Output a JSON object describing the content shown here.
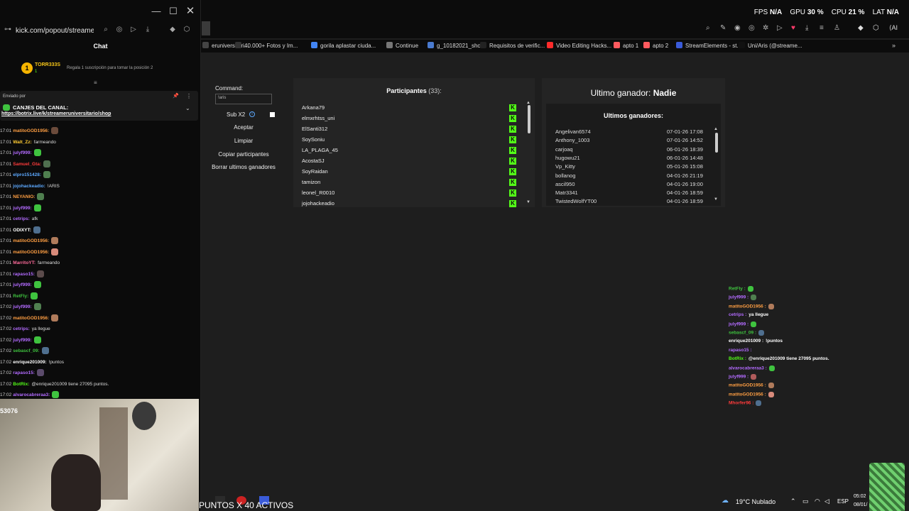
{
  "chat_window": {
    "url": "kick.com/popout/streameru",
    "title": "Chat",
    "top_gifter": {
      "name": "TORR333S",
      "sub": "1",
      "message": "Regala 1 suscripción para tomar la posición 2"
    },
    "pinned": {
      "sent_by": "Enviado por",
      "title": "CANJES DEL CANAL:",
      "link": "https://botrix.live/k/streameruniversitario/shop"
    },
    "messages": [
      {
        "time": "17:01",
        "user": "matitoGOD1956:",
        "color": "#ff9f43",
        "text": "",
        "emote": "#6b4b3b"
      },
      {
        "time": "17:01",
        "user": "Walt_Zz:",
        "color": "#ffcc33",
        "text": "farmeando",
        "emote": ""
      },
      {
        "time": "17:01",
        "user": "julyf999:",
        "color": "#b36bff",
        "text": "",
        "emote": "#3fc33f"
      },
      {
        "time": "17:01",
        "user": "Samuel_Gta:",
        "color": "#ff3b3b",
        "text": "",
        "emote": "#4f6f4f"
      },
      {
        "time": "17:01",
        "user": "elpro151428:",
        "color": "#5da9ff",
        "text": "",
        "emote": "#4f7f4f"
      },
      {
        "time": "17:01",
        "user": "jojohackeadio:",
        "color": "#5da9ff",
        "text": "!ARIS",
        "emote": ""
      },
      {
        "time": "17:01",
        "user": "NEYANIO:",
        "color": "#ff9f43",
        "text": "",
        "emote": "#4f7f4f"
      },
      {
        "time": "17:01",
        "user": "julyf999:",
        "color": "#b36bff",
        "text": "",
        "emote": "#3fc33f"
      },
      {
        "time": "17:01",
        "user": "cetrips:",
        "color": "#b36bff",
        "text": "afk",
        "emote": ""
      },
      {
        "time": "17:01",
        "user": "ODIXYT:",
        "color": "#ffffff",
        "text": "",
        "emote": "#4f6f8f"
      },
      {
        "time": "17:01",
        "user": "matitoGOD1956:",
        "color": "#ff9f43",
        "text": "",
        "emote": "#b07b5b"
      },
      {
        "time": "17:01",
        "user": "matitoGOD1956:",
        "color": "#ff9f43",
        "text": "",
        "emote": "#d88b7b"
      },
      {
        "time": "17:01",
        "user": "MarritoYT:",
        "color": "#ff6b9b",
        "text": "farmeando",
        "emote": ""
      },
      {
        "time": "17:01",
        "user": "rapaso15:",
        "color": "#b36bff",
        "text": "",
        "emote": "#5b4b4b"
      },
      {
        "time": "17:01",
        "user": "julyf999:",
        "color": "#b36bff",
        "text": "",
        "emote": "#3fc33f"
      },
      {
        "time": "17:01",
        "user": "RetFly:",
        "color": "#3fc33f",
        "text": "",
        "emote": "#3fc33f"
      },
      {
        "time": "17:02",
        "user": "julyf999:",
        "color": "#b36bff",
        "text": "",
        "emote": "#4f7f4f"
      },
      {
        "time": "17:02",
        "user": "matitoGOD1956:",
        "color": "#ff9f43",
        "text": "",
        "emote": "#b07b5b"
      },
      {
        "time": "17:02",
        "user": "cetrips:",
        "color": "#b36bff",
        "text": "ya llegue",
        "emote": ""
      },
      {
        "time": "17:02",
        "user": "julyf999:",
        "color": "#b36bff",
        "text": "",
        "emote": "#3fc33f"
      },
      {
        "time": "17:02",
        "user": "sebascf_09:",
        "color": "#3fc33f",
        "text": "",
        "emote": "#4f6f8f"
      },
      {
        "time": "17:02",
        "user": "enrique201009:",
        "color": "#ffffff",
        "text": "!puntos",
        "emote": ""
      },
      {
        "time": "17:02",
        "user": "rapaso15:",
        "color": "#b36bff",
        "text": "",
        "emote": "#5b4b6b"
      },
      {
        "time": "17:02",
        "user": "BotRix:",
        "color": "#53fc18",
        "text": "@enrique201009 tiene 27095 puntos.",
        "emote": ""
      },
      {
        "time": "17:02",
        "user": "alvarocabreraa3:",
        "color": "#b36bff",
        "text": "",
        "emote": "#3fc33f"
      }
    ],
    "webcam_counter": "53076"
  },
  "stats": {
    "fps_label": "FPS",
    "fps": "N/A",
    "gpu_label": "GPU",
    "gpu": "30 %",
    "cpu_label": "CPU",
    "cpu": "21 %",
    "lat_label": "LAT",
    "lat": "N/A"
  },
  "bookmarks": [
    {
      "label": "eruniversitari...",
      "color": "#444"
    },
    {
      "label": "40.000+ Fotos y Im...",
      "color": "#333"
    },
    {
      "label": "gorila aplastar ciuda...",
      "color": "#4285f4"
    },
    {
      "label": "Continue",
      "color": "#777"
    },
    {
      "label": "g_10182021_shcc",
      "color": "#4a7bd0"
    },
    {
      "label": "Requisitos de verific...",
      "color": "#222"
    },
    {
      "label": "Video Editing Hacks...",
      "color": "#ff2b2b"
    },
    {
      "label": "apto 1",
      "color": "#ff5a5f"
    },
    {
      "label": "apto 2",
      "color": "#ff5a5f"
    },
    {
      "label": "StreamElements - st...",
      "color": "#3a5bd9"
    },
    {
      "label": "Uni/Aris (@streame...",
      "color": "#111"
    }
  ],
  "giveaway": {
    "command_label": "Command:",
    "command_value": "!aris",
    "sub_label": "Sub X2",
    "buttons": [
      "Aceptar",
      "Limpiar",
      "Copiar participantes",
      "Borrar ultimos ganadores"
    ],
    "participants_title": "Participantes",
    "participants_count": "(33):",
    "participants": [
      "Arkana79",
      "elmxrhtss_uni",
      "ElSanti312",
      "SoySoniu",
      "LA_PLAGA_45",
      "AcostaSJ",
      "SoyRaidan",
      "tamizon",
      "leonel_R0010",
      "jojohackeadio"
    ],
    "last_winner_label": "Ultimo ganador:",
    "last_winner": "Nadie",
    "winners_title": "Ultimos ganadores:",
    "winners": [
      {
        "name": "Angelivan6574",
        "date": "07-01-26 17:08"
      },
      {
        "name": "Anthony_1003",
        "date": "07-01-26 14:52"
      },
      {
        "name": "carjoaq",
        "date": "06-01-26 18:39"
      },
      {
        "name": "hugowu21",
        "date": "06-01-26 14:48"
      },
      {
        "name": "Vp_Kitty",
        "date": "05-01-26 15:08"
      },
      {
        "name": "bollanog",
        "date": "04-01-26 21:19"
      },
      {
        "name": "ascil950",
        "date": "04-01-26 19:00"
      },
      {
        "name": "Matr3341",
        "date": "04-01-26 18:59"
      },
      {
        "name": "TwistedWolfYT00",
        "date": "04-01-26 18:59"
      }
    ]
  },
  "overlay_chat": [
    {
      "user": "RetFly :",
      "color": "#3fc33f",
      "text": "",
      "emote": "#3fc33f"
    },
    {
      "user": "julyf999 :",
      "color": "#b36bff",
      "text": "",
      "emote": "#4f7f4f"
    },
    {
      "user": "matitoGOD1956 :",
      "color": "#ff9f43",
      "text": "",
      "emote": "#b07b5b"
    },
    {
      "user": "cetrips :",
      "color": "#b36bff",
      "text": "ya llegue",
      "emote": ""
    },
    {
      "user": "julyf999 :",
      "color": "#b36bff",
      "text": "",
      "emote": "#3fc33f"
    },
    {
      "user": "sebascf_09 :",
      "color": "#3fc33f",
      "text": "",
      "emote": "#4f6f8f"
    },
    {
      "user": "enrique201009 :",
      "color": "#ffffff",
      "text": "!puntos",
      "emote": ""
    },
    {
      "user": "rapaso15 :",
      "color": "#b36bff",
      "text": "",
      "emote": ""
    },
    {
      "user": "BotRix :",
      "color": "#53fc18",
      "text": "@enrique201009 tiene 27095 puntos.",
      "emote": ""
    },
    {
      "user": "alvarocabreraa3 :",
      "color": "#b36bff",
      "text": "",
      "emote": "#3fc33f"
    },
    {
      "user": "julyf999 :",
      "color": "#b36bff",
      "text": "",
      "emote": "#b05b5b"
    },
    {
      "user": "matitoGOD1956 :",
      "color": "#ff9f43",
      "text": "",
      "emote": "#b07b5b"
    },
    {
      "user": "matitoGOD1956 :",
      "color": "#ff9f43",
      "text": "",
      "emote": "#d88b7b"
    },
    {
      "user": "Mhorfer96 :",
      "color": "#ff3b3b",
      "text": "",
      "emote": "#4f6f8f"
    }
  ],
  "footer": {
    "puntos_text": "PUNTOS X 40 ACTIVOS",
    "weather": "19°C Nublado",
    "lang": "ESP",
    "time": "05:02",
    "date": "08/01/"
  }
}
